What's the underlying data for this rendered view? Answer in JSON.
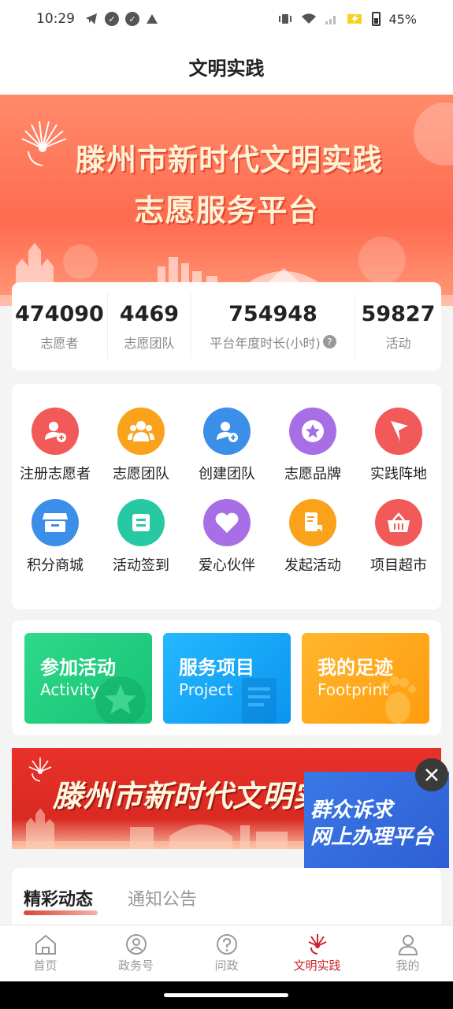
{
  "status_bar": {
    "time": "10:29",
    "battery": "45%"
  },
  "title": "文明实践",
  "banner": {
    "line1": "滕州市新时代文明实践",
    "line2": "志愿服务平台"
  },
  "stats": [
    {
      "value": "474090",
      "label": "志愿者"
    },
    {
      "value": "4469",
      "label": "志愿团队"
    },
    {
      "value": "754948",
      "label": "平台年度时长(小时)"
    },
    {
      "value": "59827",
      "label": "活动"
    }
  ],
  "menu": [
    {
      "label": "注册志愿者",
      "icon": "register-volunteer-icon",
      "color": "#f25a5a"
    },
    {
      "label": "志愿团队",
      "icon": "volunteer-team-icon",
      "color": "#f9a21a"
    },
    {
      "label": "创建团队",
      "icon": "create-team-icon",
      "color": "#3b8fe8"
    },
    {
      "label": "志愿品牌",
      "icon": "brand-star-icon",
      "color": "#a86ee6"
    },
    {
      "label": "实践阵地",
      "icon": "flag-icon",
      "color": "#f25a5a"
    },
    {
      "label": "积分商城",
      "icon": "store-icon",
      "color": "#3b8fe8"
    },
    {
      "label": "活动签到",
      "icon": "scan-checkin-icon",
      "color": "#27c9a3"
    },
    {
      "label": "爱心伙伴",
      "icon": "heart-icon",
      "color": "#a86ee6"
    },
    {
      "label": "发起活动",
      "icon": "launch-activity-icon",
      "color": "#f9a21a"
    },
    {
      "label": "项目超市",
      "icon": "basket-icon",
      "color": "#f25a5a"
    }
  ],
  "cards": [
    {
      "title": "参加活动",
      "subtitle": "Activity",
      "color": "#22cf82"
    },
    {
      "title": "服务项目",
      "subtitle": "Project",
      "color": "#1aa6f5"
    },
    {
      "title": "我的足迹",
      "subtitle": "Footprint",
      "color": "#ffac1c"
    }
  ],
  "ad_banner": {
    "text": "滕州市新时代文明实践中心"
  },
  "popup": {
    "line1": "群众诉求",
    "line2": "网上办理平台"
  },
  "news_tabs": [
    "精彩动态",
    "通知公告"
  ],
  "tab_bar": [
    {
      "label": "首页",
      "icon": "home-icon"
    },
    {
      "label": "政务号",
      "icon": "gov-account-icon"
    },
    {
      "label": "问政",
      "icon": "question-icon"
    },
    {
      "label": "文明实践",
      "icon": "civilization-icon",
      "active": true
    },
    {
      "label": "我的",
      "icon": "profile-icon"
    }
  ],
  "accent_color": "#c8252a"
}
